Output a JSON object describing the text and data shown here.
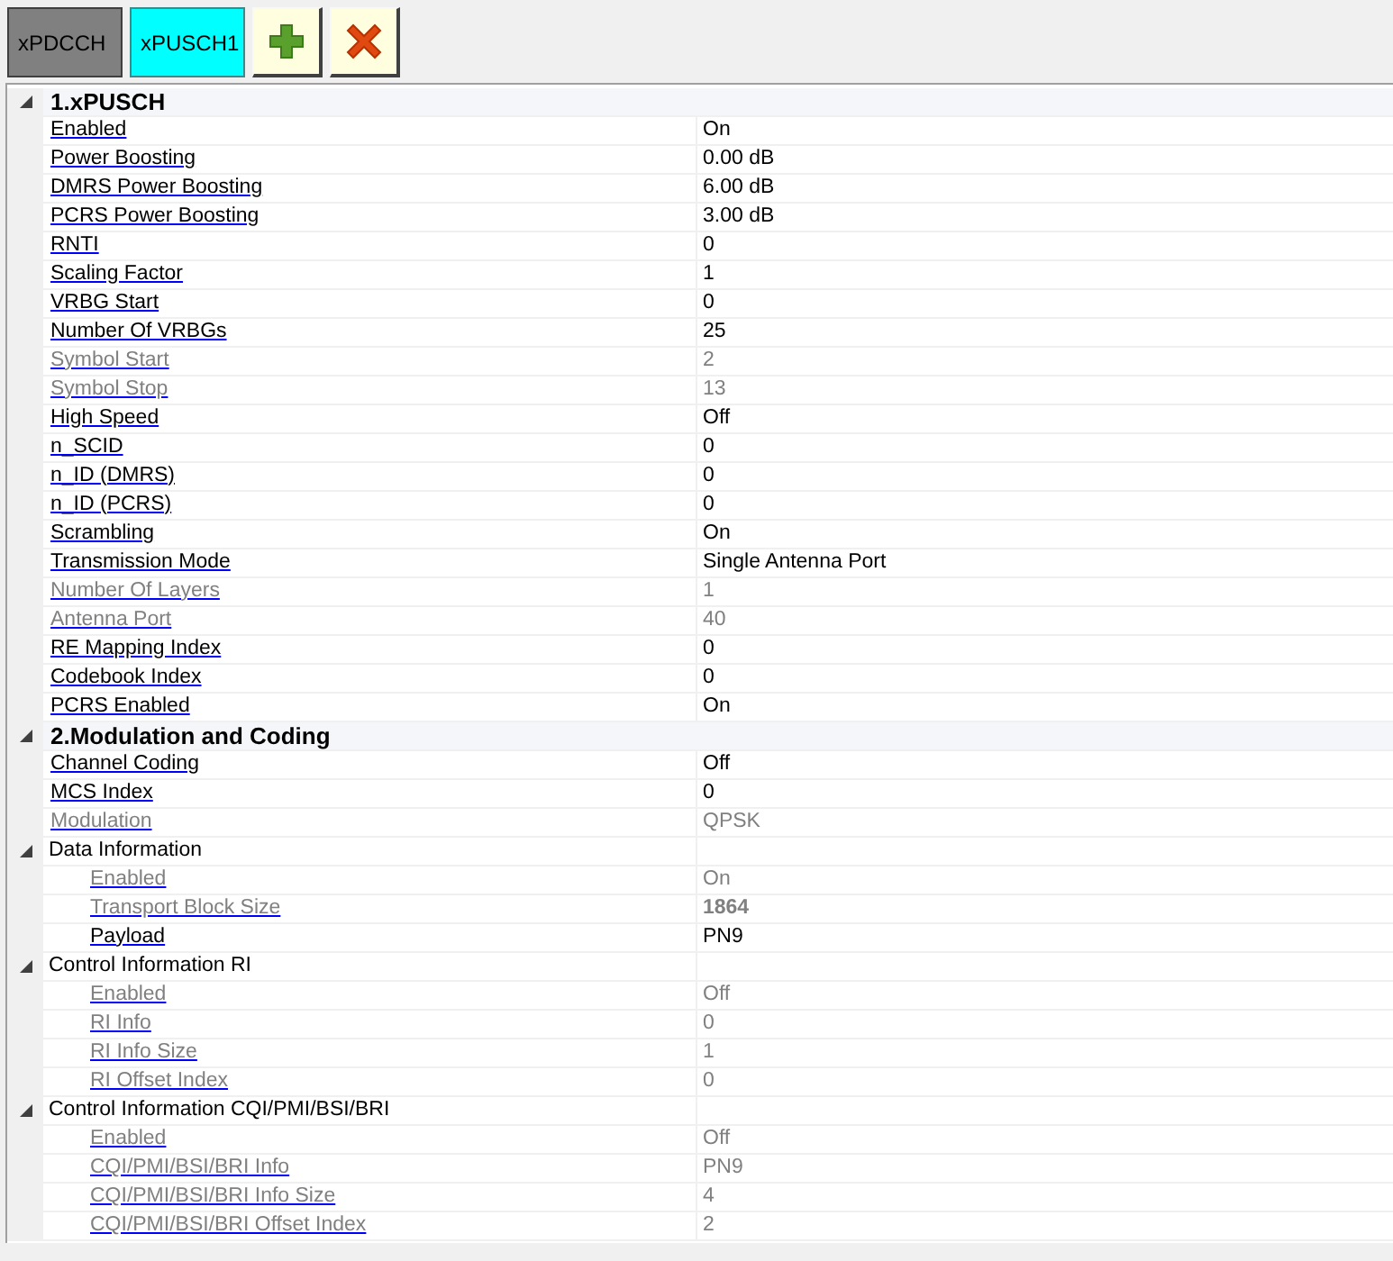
{
  "tabs": [
    {
      "label": "xPDCCH",
      "selected": false
    },
    {
      "label": "xPUSCH1",
      "selected": true
    }
  ],
  "toolbar": [
    {
      "kind": "add"
    },
    {
      "kind": "delete"
    }
  ],
  "categories": [
    {
      "kind": "category",
      "title": "1.xPUSCH",
      "expanded": true,
      "children": [
        {
          "kind": "property",
          "name": "Enabled",
          "value": "On",
          "disabled": false,
          "bold": false
        },
        {
          "kind": "property",
          "name": "Power Boosting",
          "value": "0.00 dB",
          "disabled": false,
          "bold": false
        },
        {
          "kind": "property",
          "name": "DMRS Power Boosting",
          "value": "6.00 dB",
          "disabled": false,
          "bold": false
        },
        {
          "kind": "property",
          "name": "PCRS Power Boosting",
          "value": "3.00 dB",
          "disabled": false,
          "bold": false
        },
        {
          "kind": "property",
          "name": "RNTI",
          "value": "0",
          "disabled": false,
          "bold": false
        },
        {
          "kind": "property",
          "name": "Scaling Factor",
          "value": "1",
          "disabled": false,
          "bold": false
        },
        {
          "kind": "property",
          "name": "VRBG Start",
          "value": "0",
          "disabled": false,
          "bold": false
        },
        {
          "kind": "property",
          "name": "Number Of VRBGs",
          "value": "25",
          "disabled": false,
          "bold": false
        },
        {
          "kind": "property",
          "name": "Symbol Start",
          "value": "2",
          "disabled": true,
          "bold": false
        },
        {
          "kind": "property",
          "name": "Symbol Stop",
          "value": "13",
          "disabled": true,
          "bold": false
        },
        {
          "kind": "property",
          "name": "High Speed",
          "value": "Off",
          "disabled": false,
          "bold": false
        },
        {
          "kind": "property",
          "name": "n_SCID",
          "value": "0",
          "disabled": false,
          "bold": false
        },
        {
          "kind": "property",
          "name": "n_ID (DMRS)",
          "value": "0",
          "disabled": false,
          "bold": false
        },
        {
          "kind": "property",
          "name": "n_ID (PCRS)",
          "value": "0",
          "disabled": false,
          "bold": false
        },
        {
          "kind": "property",
          "name": "Scrambling",
          "value": "On",
          "disabled": false,
          "bold": false
        },
        {
          "kind": "property",
          "name": "Transmission Mode",
          "value": "Single Antenna Port",
          "disabled": false,
          "bold": false
        },
        {
          "kind": "property",
          "name": "Number Of Layers",
          "value": "1",
          "disabled": true,
          "bold": false
        },
        {
          "kind": "property",
          "name": "Antenna Port",
          "value": "40",
          "disabled": true,
          "bold": false
        },
        {
          "kind": "property",
          "name": "RE Mapping Index",
          "value": "0",
          "disabled": false,
          "bold": false
        },
        {
          "kind": "property",
          "name": "Codebook Index",
          "value": "0",
          "disabled": false,
          "bold": false
        },
        {
          "kind": "property",
          "name": "PCRS Enabled",
          "value": "On",
          "disabled": false,
          "bold": false
        }
      ]
    },
    {
      "kind": "category",
      "title": "2.Modulation and Coding",
      "expanded": true,
      "children": [
        {
          "kind": "property",
          "name": "Channel Coding",
          "value": "Off",
          "disabled": false,
          "bold": false
        },
        {
          "kind": "property",
          "name": "MCS Index",
          "value": "0",
          "disabled": false,
          "bold": false
        },
        {
          "kind": "property",
          "name": "Modulation",
          "value": "QPSK",
          "disabled": true,
          "bold": false
        },
        {
          "kind": "group",
          "title": "Data Information",
          "expanded": true,
          "children": [
            {
              "kind": "property",
              "name": "Enabled",
              "value": "On",
              "disabled": true,
              "bold": false
            },
            {
              "kind": "property",
              "name": "Transport Block Size",
              "value": "1864",
              "disabled": true,
              "bold": true
            },
            {
              "kind": "property",
              "name": "Payload",
              "value": "PN9",
              "disabled": false,
              "bold": false
            }
          ]
        },
        {
          "kind": "group",
          "title": "Control Information RI",
          "expanded": true,
          "children": [
            {
              "kind": "property",
              "name": "Enabled",
              "value": "Off",
              "disabled": true,
              "bold": false
            },
            {
              "kind": "property",
              "name": "RI Info",
              "value": "0",
              "disabled": true,
              "bold": false
            },
            {
              "kind": "property",
              "name": "RI Info Size",
              "value": "1",
              "disabled": true,
              "bold": false
            },
            {
              "kind": "property",
              "name": "RI Offset Index",
              "value": "0",
              "disabled": true,
              "bold": false
            }
          ]
        },
        {
          "kind": "group",
          "title": "Control Information CQI/PMI/BSI/BRI",
          "expanded": true,
          "children": [
            {
              "kind": "property",
              "name": "Enabled",
              "value": "Off",
              "disabled": true,
              "bold": false
            },
            {
              "kind": "property",
              "name": "CQI/PMI/BSI/BRI Info",
              "value": "PN9",
              "disabled": true,
              "bold": false
            },
            {
              "kind": "property",
              "name": "CQI/PMI/BSI/BRI Info Size",
              "value": "4",
              "disabled": true,
              "bold": false
            },
            {
              "kind": "property",
              "name": "CQI/PMI/BSI/BRI Offset Index",
              "value": "2",
              "disabled": true,
              "bold": false
            }
          ]
        }
      ]
    }
  ]
}
